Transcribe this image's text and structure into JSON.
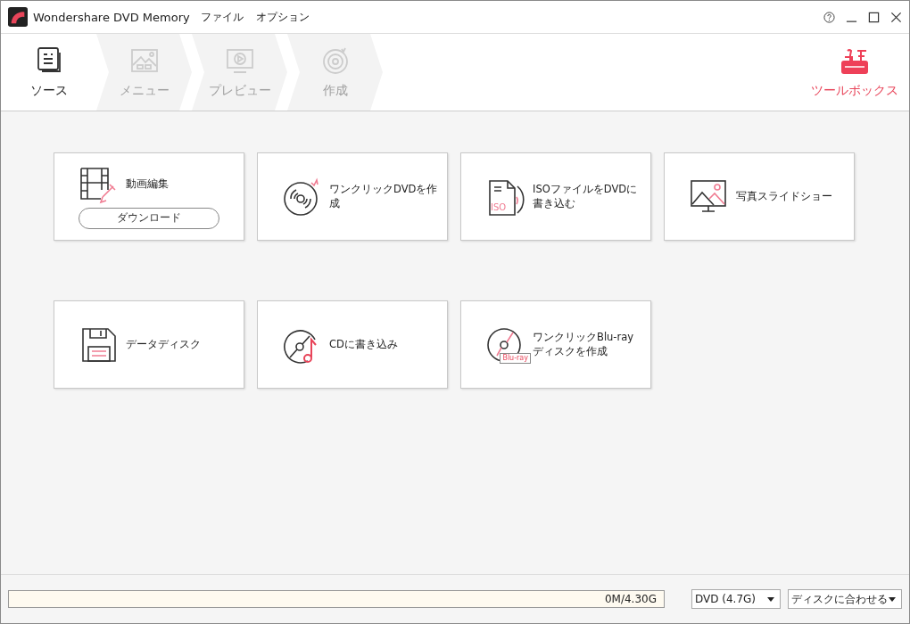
{
  "window": {
    "title": "Wondershare DVD Memory",
    "menu": [
      "ファイル",
      "オプション"
    ]
  },
  "steps": [
    {
      "label": "ソース",
      "kind": "source",
      "selected": true
    },
    {
      "label": "メニュー",
      "kind": "menu",
      "selected": false
    },
    {
      "label": "プレビュー",
      "kind": "preview",
      "selected": false
    },
    {
      "label": "作成",
      "kind": "burn",
      "selected": false
    }
  ],
  "toolbox": {
    "label": "ツールボックス"
  },
  "tiles": [
    {
      "label": "動画編集",
      "kind": "video-edit",
      "button": "ダウンロード"
    },
    {
      "label": "ワンクリックDVDを作成",
      "kind": "dvd"
    },
    {
      "label": "ISOファイルをDVDに書き込む",
      "kind": "iso",
      "badge": "ISO"
    },
    {
      "label": "写真スライドショー",
      "kind": "photo"
    },
    {
      "label": "データディスク",
      "kind": "data"
    },
    {
      "label": "CDに書き込み",
      "kind": "cd"
    },
    {
      "label": "ワンクリックBlu-rayディスクを作成",
      "kind": "bluray",
      "badge": "Blu-ray"
    }
  ],
  "status_bar": {
    "capacity": {
      "reading": "0M/4.30G"
    },
    "disc_type": "DVD (4.7G)",
    "fit_mode": "ディスクに合わせる"
  }
}
